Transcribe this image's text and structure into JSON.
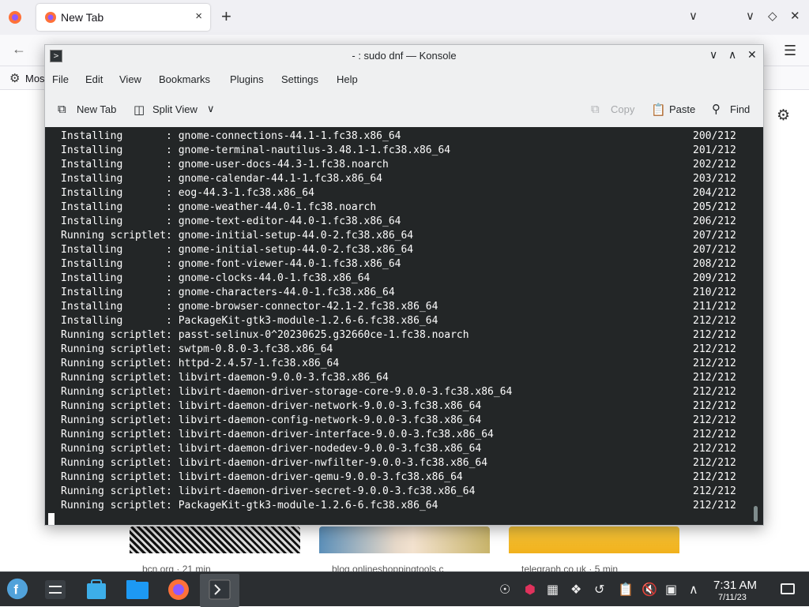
{
  "firefox": {
    "tab_label": "New Tab",
    "tab_close": "×",
    "new_tab_glyph": "+",
    "bookmark_label": "Mos",
    "cards": [
      {
        "source": "bcn.org · 21 min"
      },
      {
        "source": "blog.onlineshoppingtools.c"
      },
      {
        "source": "telegraph.co.uk · 5 min"
      }
    ]
  },
  "konsole": {
    "title": "- : sudo dnf — Konsole",
    "menu": [
      "File",
      "Edit",
      "View",
      "Bookmarks",
      "Plugins",
      "Settings",
      "Help"
    ],
    "toolbar": {
      "new_tab": "New Tab",
      "split_view": "Split View",
      "copy": "Copy",
      "paste": "Paste",
      "find": "Find"
    },
    "lines": [
      {
        "action": "Installing       : ",
        "pkg": "gnome-connections-44.1-1.fc38.x86_64",
        "count": "200/212"
      },
      {
        "action": "Installing       : ",
        "pkg": "gnome-terminal-nautilus-3.48.1-1.fc38.x86_64",
        "count": "201/212"
      },
      {
        "action": "Installing       : ",
        "pkg": "gnome-user-docs-44.3-1.fc38.noarch",
        "count": "202/212"
      },
      {
        "action": "Installing       : ",
        "pkg": "gnome-calendar-44.1-1.fc38.x86_64",
        "count": "203/212"
      },
      {
        "action": "Installing       : ",
        "pkg": "eog-44.3-1.fc38.x86_64",
        "count": "204/212"
      },
      {
        "action": "Installing       : ",
        "pkg": "gnome-weather-44.0-1.fc38.noarch",
        "count": "205/212"
      },
      {
        "action": "Installing       : ",
        "pkg": "gnome-text-editor-44.0-1.fc38.x86_64",
        "count": "206/212"
      },
      {
        "action": "Running scriptlet: ",
        "pkg": "gnome-initial-setup-44.0-2.fc38.x86_64",
        "count": "207/212"
      },
      {
        "action": "Installing       : ",
        "pkg": "gnome-initial-setup-44.0-2.fc38.x86_64",
        "count": "207/212"
      },
      {
        "action": "Installing       : ",
        "pkg": "gnome-font-viewer-44.0-1.fc38.x86_64",
        "count": "208/212"
      },
      {
        "action": "Installing       : ",
        "pkg": "gnome-clocks-44.0-1.fc38.x86_64",
        "count": "209/212"
      },
      {
        "action": "Installing       : ",
        "pkg": "gnome-characters-44.0-1.fc38.x86_64",
        "count": "210/212"
      },
      {
        "action": "Installing       : ",
        "pkg": "gnome-browser-connector-42.1-2.fc38.x86_64",
        "count": "211/212"
      },
      {
        "action": "Installing       : ",
        "pkg": "PackageKit-gtk3-module-1.2.6-6.fc38.x86_64",
        "count": "212/212"
      },
      {
        "action": "Running scriptlet: ",
        "pkg": "passt-selinux-0^20230625.g32660ce-1.fc38.noarch",
        "count": "212/212"
      },
      {
        "action": "Running scriptlet: ",
        "pkg": "swtpm-0.8.0-3.fc38.x86_64",
        "count": "212/212"
      },
      {
        "action": "Running scriptlet: ",
        "pkg": "httpd-2.4.57-1.fc38.x86_64",
        "count": "212/212"
      },
      {
        "action": "Running scriptlet: ",
        "pkg": "libvirt-daemon-9.0.0-3.fc38.x86_64",
        "count": "212/212"
      },
      {
        "action": "Running scriptlet: ",
        "pkg": "libvirt-daemon-driver-storage-core-9.0.0-3.fc38.x86_64",
        "count": "212/212"
      },
      {
        "action": "Running scriptlet: ",
        "pkg": "libvirt-daemon-driver-network-9.0.0-3.fc38.x86_64",
        "count": "212/212"
      },
      {
        "action": "Running scriptlet: ",
        "pkg": "libvirt-daemon-config-network-9.0.0-3.fc38.x86_64",
        "count": "212/212"
      },
      {
        "action": "Running scriptlet: ",
        "pkg": "libvirt-daemon-driver-interface-9.0.0-3.fc38.x86_64",
        "count": "212/212"
      },
      {
        "action": "Running scriptlet: ",
        "pkg": "libvirt-daemon-driver-nodedev-9.0.0-3.fc38.x86_64",
        "count": "212/212"
      },
      {
        "action": "Running scriptlet: ",
        "pkg": "libvirt-daemon-driver-nwfilter-9.0.0-3.fc38.x86_64",
        "count": "212/212"
      },
      {
        "action": "Running scriptlet: ",
        "pkg": "libvirt-daemon-driver-qemu-9.0.0-3.fc38.x86_64",
        "count": "212/212"
      },
      {
        "action": "Running scriptlet: ",
        "pkg": "libvirt-daemon-driver-secret-9.0.0-3.fc38.x86_64",
        "count": "212/212"
      },
      {
        "action": "Running scriptlet: ",
        "pkg": "PackageKit-gtk3-module-1.2.6-6.fc38.x86_64",
        "count": "212/212"
      }
    ]
  },
  "taskbar": {
    "apps": [
      "fedora-launcher-icon",
      "system-settings-icon",
      "discover-icon",
      "dolphin-icon",
      "firefox-icon",
      "konsole-icon"
    ],
    "time": "7:31 AM",
    "date": "7/11/23"
  },
  "colors": {
    "terminal_bg": "#232627",
    "terminal_fg": "#fcfcfc",
    "taskbar_bg": "#2b2e31",
    "window_bg": "#eff0f1"
  }
}
